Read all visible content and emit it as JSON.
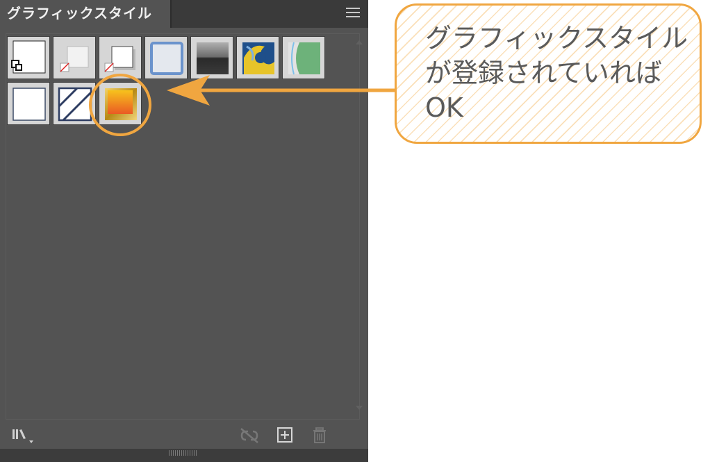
{
  "panel": {
    "title": "グラフィックスタイル",
    "menu_icon": "hamburger-menu-icon",
    "swatches": [
      {
        "name": "default-style-swatch",
        "icon": "default-style-icon"
      },
      {
        "name": "default-no-stroke-swatch",
        "icon": "no-stroke-square-icon"
      },
      {
        "name": "shadow-style-swatch",
        "icon": "drop-shadow-square-icon"
      },
      {
        "name": "blue-outline-swatch",
        "icon": "blue-outline-icon"
      },
      {
        "name": "gradient-gray-swatch",
        "icon": "gray-gradient-icon"
      },
      {
        "name": "blue-yellow-pattern-swatch",
        "icon": "pattern-icon"
      },
      {
        "name": "green-half-swatch",
        "icon": "green-half-icon"
      },
      {
        "name": "white-square-swatch",
        "icon": "white-square-icon"
      },
      {
        "name": "hatched-swatch",
        "icon": "diagonal-hatch-icon"
      },
      {
        "name": "gold-gradient-swatch",
        "icon": "gold-gradient-icon"
      }
    ],
    "toolbar": {
      "library_icon": "graphic-style-library-icon",
      "break_link_icon": "break-link-icon",
      "new_style_icon": "new-graphic-style-icon",
      "delete_icon": "trash-icon"
    }
  },
  "annotation": {
    "lines": [
      "グラフィックスタイル",
      "が登録されていれば",
      "OK"
    ],
    "accent_color": "#f0a640"
  }
}
